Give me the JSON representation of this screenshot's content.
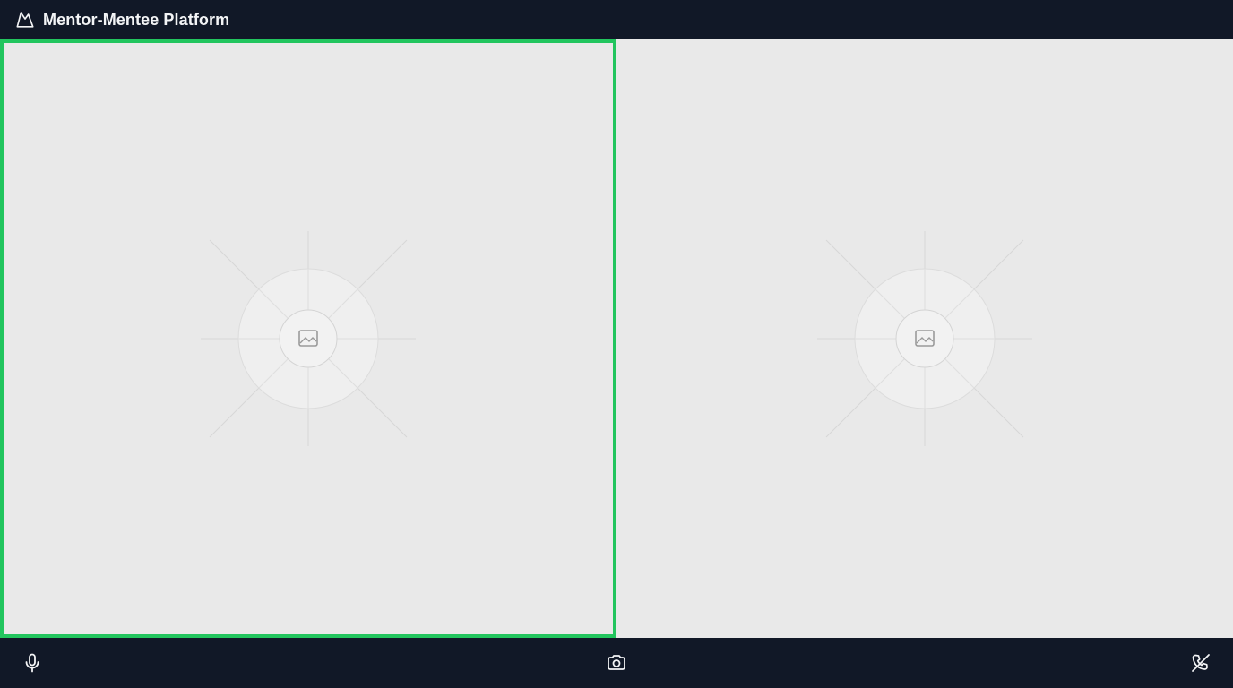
{
  "app": {
    "title": "Mentor-Mentee Platform",
    "logo_icon": "mountain-logo-icon"
  },
  "video": {
    "tiles": [
      {
        "name": "video-tile-1",
        "active": true,
        "placeholder_icon": "image-placeholder-icon"
      },
      {
        "name": "video-tile-2",
        "active": false,
        "placeholder_icon": "image-placeholder-icon"
      }
    ],
    "active_border_color": "#22c55e"
  },
  "controls": {
    "mic_icon": "microphone-icon",
    "camera_icon": "camera-icon",
    "end_call_icon": "phone-off-icon"
  },
  "colors": {
    "bar_background": "#111827",
    "stage_background": "#e9e9e9"
  }
}
